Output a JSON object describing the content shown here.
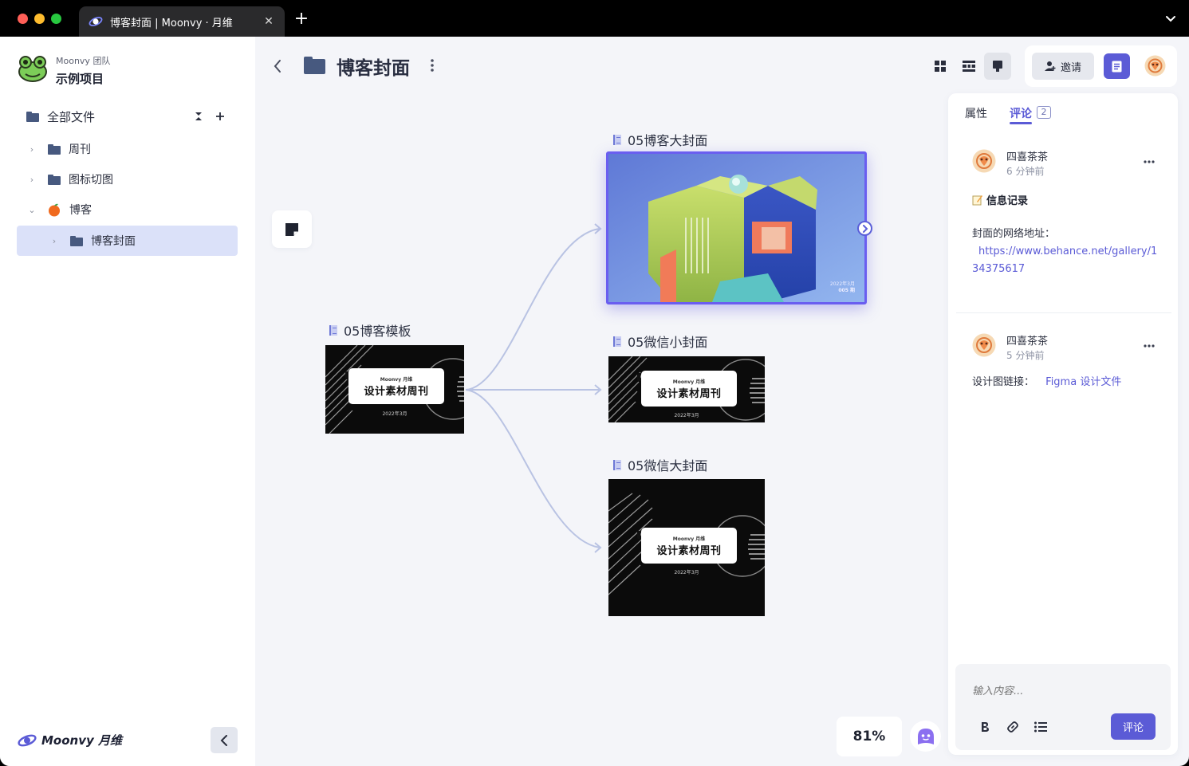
{
  "browser": {
    "tab_title": "博客封面 | Moonvy · 月维",
    "close_glyph": "✕",
    "new_tab_glyph": "+"
  },
  "sidebar": {
    "team_name": "Moonvy 团队",
    "project_name": "示例项目",
    "root_label": "全部文件",
    "items": [
      {
        "label": "周刊",
        "icon": "folder-icon",
        "expanded": false
      },
      {
        "label": "图标切图",
        "icon": "folder-icon",
        "expanded": false
      },
      {
        "label": "博客",
        "icon": "orange-emoji-icon",
        "expanded": true
      },
      {
        "label": "博客封面",
        "icon": "folder-icon",
        "expanded": false,
        "selected": true
      }
    ],
    "brand_name": "Moonvy 月维"
  },
  "header": {
    "title": "博客封面",
    "invite_label": "邀请",
    "view_modes": [
      "grid-view",
      "list-view",
      "canvas-view"
    ],
    "active_view": "canvas-view"
  },
  "canvas": {
    "nodes": {
      "template": {
        "label": "05博客模板"
      },
      "hero": {
        "label": "05博客大封面",
        "date": "2022年3月",
        "issue": "005 期"
      },
      "wechat_small": {
        "label": "05微信小封面"
      },
      "wechat_large": {
        "label": "05微信大封面"
      }
    },
    "thumbnail": {
      "badge": "005",
      "brand": "Moonvy 月维",
      "title": "设计素材周刊",
      "date": "2022年3月"
    },
    "zoom": "81%"
  },
  "panel": {
    "tabs": {
      "properties": "属性",
      "comments": "评论",
      "comment_count": "2"
    },
    "comments": [
      {
        "author": "四喜茶茶",
        "time": "6 分钟前",
        "heading": "信息记录",
        "body_label": "封面的网络地址：",
        "link_line1": "https://www.behance.net/gallery/1",
        "link_line2": "34375617"
      },
      {
        "author": "四喜茶茶",
        "time": "5 分钟前",
        "body_label": "设计图链接：",
        "link": "Figma 设计文件"
      }
    ],
    "composer": {
      "placeholder": "输入内容...",
      "submit_label": "评论"
    }
  },
  "colors": {
    "accent": "#5b5bd6",
    "folder": "#47597f",
    "selected_row": "#dbe1f9",
    "connector": "#b9c3e3"
  }
}
